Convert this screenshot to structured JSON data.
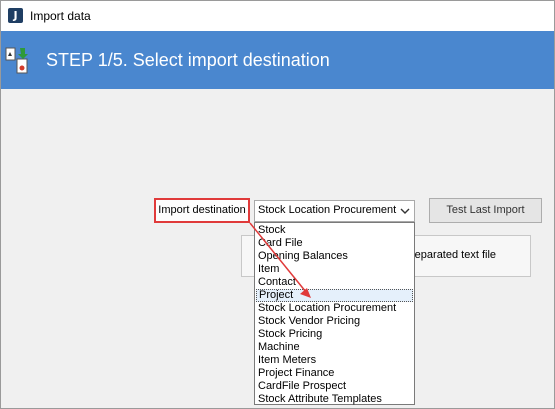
{
  "window": {
    "title": "Import data"
  },
  "header": {
    "step_title": "STEP 1/5. Select import destination",
    "background": "#4a87cf"
  },
  "form": {
    "destination_label": "Import destination",
    "selected_value": "Stock Location Procurement",
    "test_button_label": "Test Last Import",
    "partial_panel_text": "n separated text file"
  },
  "dropdown": {
    "items": [
      "Stock",
      "Card File",
      "Opening Balances",
      "Item",
      "Contact",
      "Project",
      "Stock Location Procurement",
      "Stock Vendor Pricing",
      "Stock Pricing",
      "Machine",
      "Item Meters",
      "Project Finance",
      "CardFile Prospect",
      "Stock Attribute Templates"
    ],
    "highlighted_item": "Project"
  },
  "annotation": {
    "color": "#e03a3a"
  },
  "icons": {
    "app": "app-logo-icon",
    "header": "import-files-icon",
    "combo": "chevron-down-icon"
  }
}
